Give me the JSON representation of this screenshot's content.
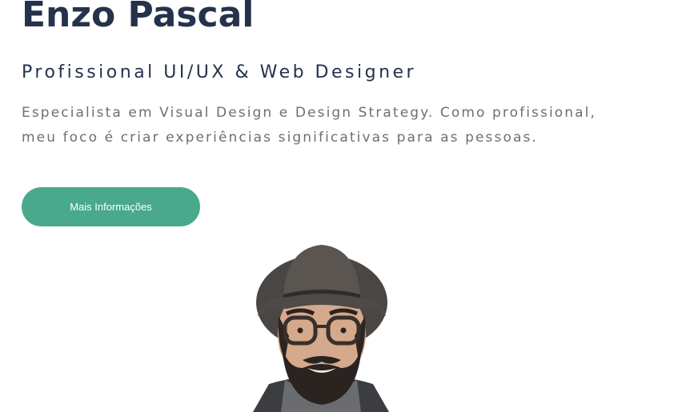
{
  "hero": {
    "name": "Enzo Pascal",
    "role": "Profissional UI/UX & Web Designer",
    "bio": "Especialista em Visual Design e Design Strategy. Como profissional, meu foco é criar experiências significativas para as pessoas.",
    "cta_label": "Mais Informações"
  },
  "colors": {
    "heading": "#25324b",
    "body_text": "#6f6f6f",
    "accent": "#49a98d",
    "background": "#ffffff"
  },
  "icons": {
    "portrait": "person-photo-icon"
  }
}
